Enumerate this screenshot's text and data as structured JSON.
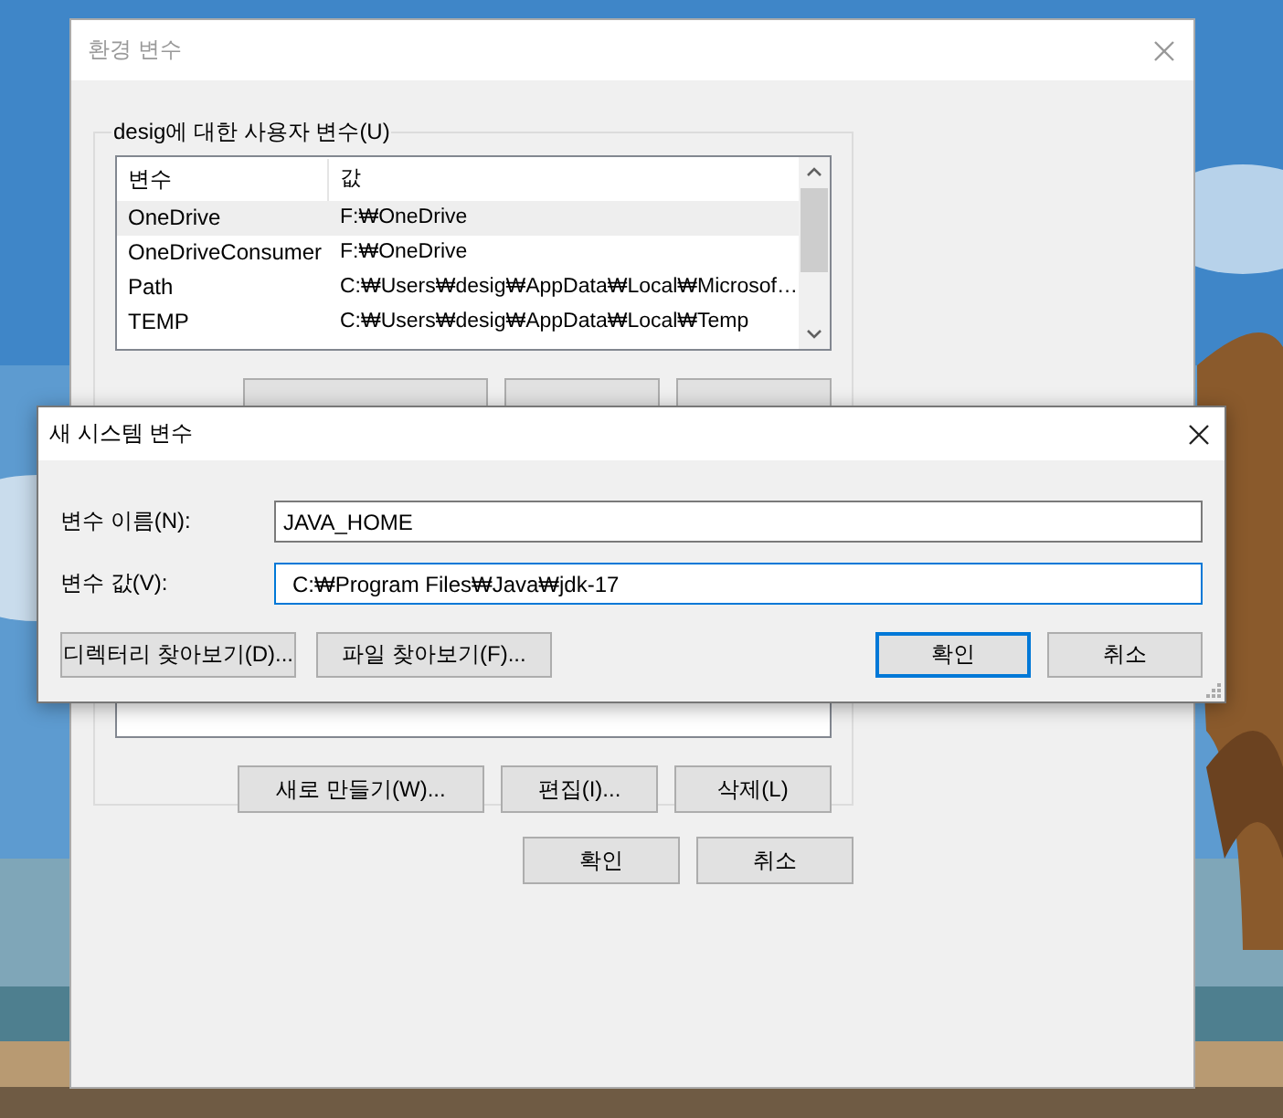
{
  "main_window": {
    "title": "환경 변수",
    "user_variables": {
      "label": "desig에 대한 사용자 변수(U)",
      "columns": [
        "변수",
        "값"
      ],
      "rows": [
        {
          "name": "OneDrive",
          "value": "F:₩OneDrive",
          "selected": true
        },
        {
          "name": "OneDriveConsumer",
          "value": "F:₩OneDrive",
          "selected": false
        },
        {
          "name": "Path",
          "value": "C:₩Users₩desig₩AppData₩Local₩Microsof…",
          "selected": false
        },
        {
          "name": "TEMP",
          "value": "C:₩Users₩desig₩AppData₩Local₩Temp",
          "selected": false
        }
      ]
    },
    "system_variables": {
      "buttons": [
        "새로 만들기(W)...",
        "편집(I)...",
        "삭제(L)"
      ]
    },
    "buttons": [
      "확인",
      "취소"
    ]
  },
  "dialog": {
    "title": "새 시스템 변수",
    "fields": [
      {
        "label": "변수 이름(N):",
        "value": "JAVA_HOME",
        "focused": false
      },
      {
        "label": "변수 값(V):",
        "value": "C:₩Program Files₩Java₩jdk-17",
        "focused": true
      }
    ],
    "browse_buttons": [
      "디렉터리 찾아보기(D)...",
      "파일 찾아보기(F)..."
    ],
    "buttons": [
      {
        "label": "확인",
        "default": true
      },
      {
        "label": "취소",
        "default": false
      }
    ]
  }
}
